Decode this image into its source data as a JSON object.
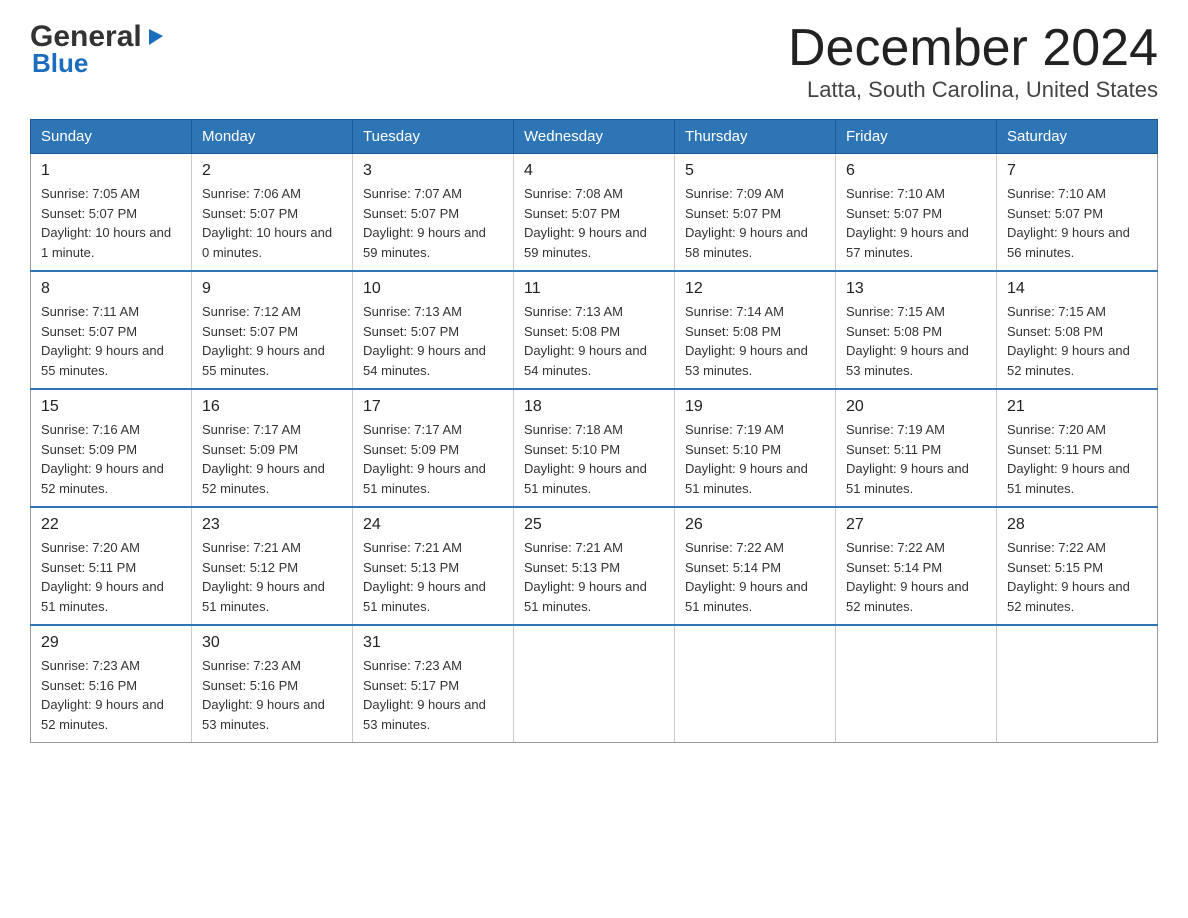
{
  "header": {
    "logo_general": "General",
    "logo_blue": "Blue",
    "month_title": "December 2024",
    "location": "Latta, South Carolina, United States"
  },
  "weekdays": [
    "Sunday",
    "Monday",
    "Tuesday",
    "Wednesday",
    "Thursday",
    "Friday",
    "Saturday"
  ],
  "weeks": [
    [
      {
        "day": "1",
        "sunrise": "7:05 AM",
        "sunset": "5:07 PM",
        "daylight": "10 hours and 1 minute."
      },
      {
        "day": "2",
        "sunrise": "7:06 AM",
        "sunset": "5:07 PM",
        "daylight": "10 hours and 0 minutes."
      },
      {
        "day": "3",
        "sunrise": "7:07 AM",
        "sunset": "5:07 PM",
        "daylight": "9 hours and 59 minutes."
      },
      {
        "day": "4",
        "sunrise": "7:08 AM",
        "sunset": "5:07 PM",
        "daylight": "9 hours and 59 minutes."
      },
      {
        "day": "5",
        "sunrise": "7:09 AM",
        "sunset": "5:07 PM",
        "daylight": "9 hours and 58 minutes."
      },
      {
        "day": "6",
        "sunrise": "7:10 AM",
        "sunset": "5:07 PM",
        "daylight": "9 hours and 57 minutes."
      },
      {
        "day": "7",
        "sunrise": "7:10 AM",
        "sunset": "5:07 PM",
        "daylight": "9 hours and 56 minutes."
      }
    ],
    [
      {
        "day": "8",
        "sunrise": "7:11 AM",
        "sunset": "5:07 PM",
        "daylight": "9 hours and 55 minutes."
      },
      {
        "day": "9",
        "sunrise": "7:12 AM",
        "sunset": "5:07 PM",
        "daylight": "9 hours and 55 minutes."
      },
      {
        "day": "10",
        "sunrise": "7:13 AM",
        "sunset": "5:07 PM",
        "daylight": "9 hours and 54 minutes."
      },
      {
        "day": "11",
        "sunrise": "7:13 AM",
        "sunset": "5:08 PM",
        "daylight": "9 hours and 54 minutes."
      },
      {
        "day": "12",
        "sunrise": "7:14 AM",
        "sunset": "5:08 PM",
        "daylight": "9 hours and 53 minutes."
      },
      {
        "day": "13",
        "sunrise": "7:15 AM",
        "sunset": "5:08 PM",
        "daylight": "9 hours and 53 minutes."
      },
      {
        "day": "14",
        "sunrise": "7:15 AM",
        "sunset": "5:08 PM",
        "daylight": "9 hours and 52 minutes."
      }
    ],
    [
      {
        "day": "15",
        "sunrise": "7:16 AM",
        "sunset": "5:09 PM",
        "daylight": "9 hours and 52 minutes."
      },
      {
        "day": "16",
        "sunrise": "7:17 AM",
        "sunset": "5:09 PM",
        "daylight": "9 hours and 52 minutes."
      },
      {
        "day": "17",
        "sunrise": "7:17 AM",
        "sunset": "5:09 PM",
        "daylight": "9 hours and 51 minutes."
      },
      {
        "day": "18",
        "sunrise": "7:18 AM",
        "sunset": "5:10 PM",
        "daylight": "9 hours and 51 minutes."
      },
      {
        "day": "19",
        "sunrise": "7:19 AM",
        "sunset": "5:10 PM",
        "daylight": "9 hours and 51 minutes."
      },
      {
        "day": "20",
        "sunrise": "7:19 AM",
        "sunset": "5:11 PM",
        "daylight": "9 hours and 51 minutes."
      },
      {
        "day": "21",
        "sunrise": "7:20 AM",
        "sunset": "5:11 PM",
        "daylight": "9 hours and 51 minutes."
      }
    ],
    [
      {
        "day": "22",
        "sunrise": "7:20 AM",
        "sunset": "5:11 PM",
        "daylight": "9 hours and 51 minutes."
      },
      {
        "day": "23",
        "sunrise": "7:21 AM",
        "sunset": "5:12 PM",
        "daylight": "9 hours and 51 minutes."
      },
      {
        "day": "24",
        "sunrise": "7:21 AM",
        "sunset": "5:13 PM",
        "daylight": "9 hours and 51 minutes."
      },
      {
        "day": "25",
        "sunrise": "7:21 AM",
        "sunset": "5:13 PM",
        "daylight": "9 hours and 51 minutes."
      },
      {
        "day": "26",
        "sunrise": "7:22 AM",
        "sunset": "5:14 PM",
        "daylight": "9 hours and 51 minutes."
      },
      {
        "day": "27",
        "sunrise": "7:22 AM",
        "sunset": "5:14 PM",
        "daylight": "9 hours and 52 minutes."
      },
      {
        "day": "28",
        "sunrise": "7:22 AM",
        "sunset": "5:15 PM",
        "daylight": "9 hours and 52 minutes."
      }
    ],
    [
      {
        "day": "29",
        "sunrise": "7:23 AM",
        "sunset": "5:16 PM",
        "daylight": "9 hours and 52 minutes."
      },
      {
        "day": "30",
        "sunrise": "7:23 AM",
        "sunset": "5:16 PM",
        "daylight": "9 hours and 53 minutes."
      },
      {
        "day": "31",
        "sunrise": "7:23 AM",
        "sunset": "5:17 PM",
        "daylight": "9 hours and 53 minutes."
      },
      null,
      null,
      null,
      null
    ]
  ],
  "labels": {
    "sunrise": "Sunrise:",
    "sunset": "Sunset:",
    "daylight": "Daylight:"
  }
}
